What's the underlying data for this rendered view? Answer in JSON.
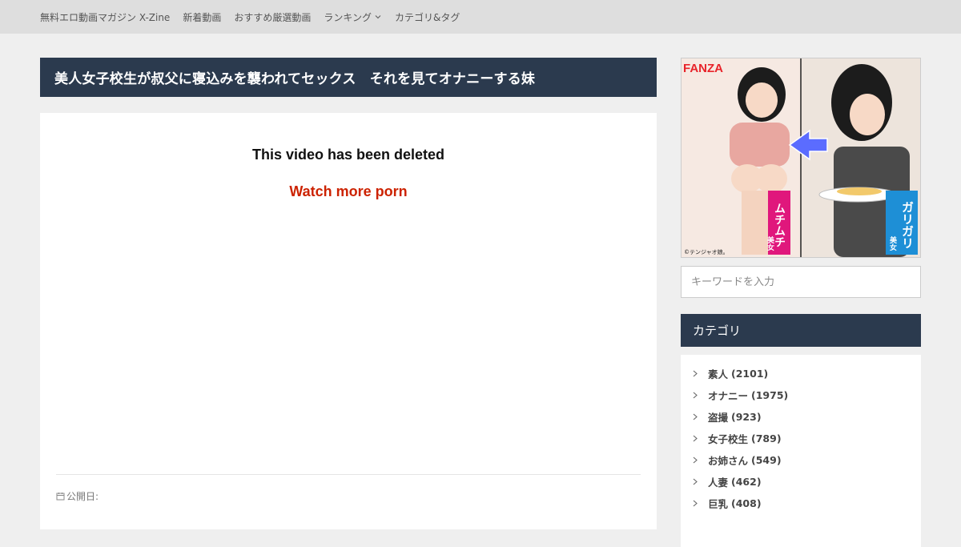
{
  "nav": {
    "items": [
      {
        "label": "無料エロ動画マガジン X-Zine"
      },
      {
        "label": "新着動画"
      },
      {
        "label": "おすすめ厳選動画"
      },
      {
        "label": "ランキング"
      },
      {
        "label": "カテゴリ&タグ"
      }
    ]
  },
  "post": {
    "title": "美人女子校生が叔父に寝込みを襲われてセックス　それを見てオナニーする妹",
    "deleted_message": "This video has been deleted",
    "watch_more": "Watch more porn",
    "published_label": "公開日:"
  },
  "banner": {
    "brand": "FANZA",
    "left_tag": "ムチムチ",
    "left_sub": "美女",
    "right_tag": "ガリガリ",
    "right_sub": "美女",
    "credit": "©テンジャオ娘。",
    "colors": {
      "left_tag": "#e0177c",
      "right_tag": "#1e8fd6",
      "brand": "#e8232a"
    }
  },
  "search": {
    "placeholder": "キーワードを入力"
  },
  "categories": {
    "heading": "カテゴリ",
    "items": [
      {
        "label": "素人",
        "count": "(2101)"
      },
      {
        "label": "オナニー",
        "count": "(1975)"
      },
      {
        "label": "盗撮",
        "count": "(923)"
      },
      {
        "label": "女子校生",
        "count": "(789)"
      },
      {
        "label": "お姉さん",
        "count": "(549)"
      },
      {
        "label": "人妻",
        "count": "(462)"
      },
      {
        "label": "巨乳",
        "count": "(408)"
      }
    ]
  },
  "theme": {
    "header_bg": "#2b3a4e",
    "link_red": "#cc2200",
    "page_bg": "#efefef"
  }
}
